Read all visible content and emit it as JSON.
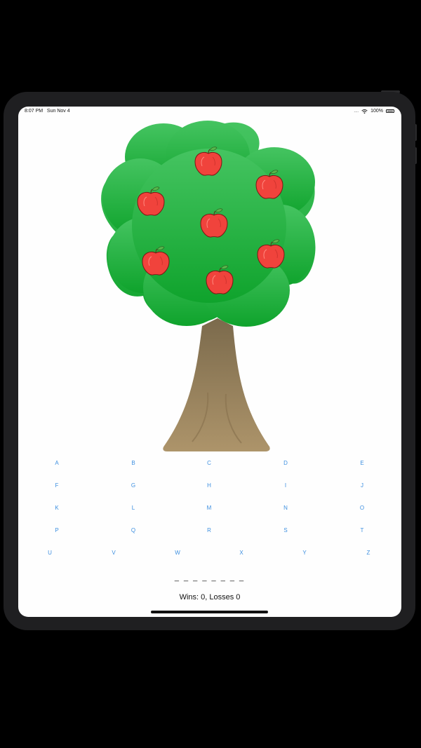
{
  "status_bar": {
    "time": "8:07 PM",
    "date": "Sun Nov 4",
    "signal_dots": "....",
    "battery": "100%"
  },
  "tree": {
    "apples_remaining": 7,
    "colors": {
      "foliage_top": "#45c461",
      "foliage_bottom": "#0fa32c",
      "trunk_top": "#7b6a4c",
      "trunk_bottom": "#ad946a",
      "apple": "#f0433c"
    }
  },
  "letters": [
    "A",
    "B",
    "C",
    "D",
    "E",
    "F",
    "G",
    "H",
    "I",
    "J",
    "K",
    "L",
    "M",
    "N",
    "O",
    "P",
    "Q",
    "R",
    "S",
    "T",
    "U",
    "V",
    "W",
    "X",
    "Y",
    "Z"
  ],
  "accent_color": "#3d8fe0",
  "game": {
    "word_display": "_ _ _ _ _ _ _ _",
    "score_text": "Wins: 0, Losses 0"
  }
}
